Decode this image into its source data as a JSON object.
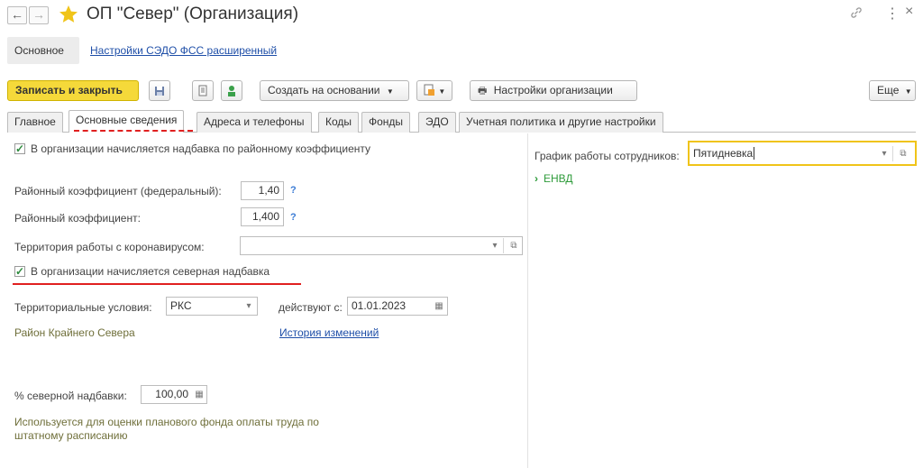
{
  "window": {
    "back": "←",
    "forward": "→",
    "title": "ОП \"Север\" (Организация)",
    "link_icon": "🔗",
    "more_icon": "⋮",
    "close_icon": "×"
  },
  "nav": {
    "main": "Основное",
    "link": "Настройки СЭДО ФСС расширенный"
  },
  "toolbar": {
    "save_close": "Записать и закрыть",
    "create_based": "Создать на основании",
    "org_settings": "Настройки организации",
    "more": "Еще"
  },
  "tabs": [
    "Главное",
    "Основные сведения",
    "Адреса и телефоны",
    "Коды",
    "Фонды",
    "ЭДО",
    "Учетная политика и другие настройки"
  ],
  "form": {
    "district_allowance_check": "В организации начисляется надбавка по районному коэффициенту",
    "district_coef_federal_label": "Районный коэффициент (федеральный):",
    "district_coef_federal_value": "1,40",
    "district_coef_label": "Районный коэффициент:",
    "district_coef_value": "1,400",
    "help_mark": "?",
    "covid_label": "Территория работы с коронавирусом:",
    "covid_value": "",
    "northern_check": "В организации начисляется северная надбавка",
    "territorial_label": "Территориальные условия:",
    "territorial_value": "РКС",
    "valid_from_label": "действуют с:",
    "valid_from_value": "01.01.2023",
    "district_name": "Район Крайнего Севера",
    "history_link": "История изменений",
    "northern_pct_label": "% северной надбавки:",
    "northern_pct_value": "100,00",
    "note_line1": "Используется для оценки планового фонда оплаты труда по",
    "note_line2": "штатному расписанию"
  },
  "right": {
    "schedule_label": "График работы сотрудников:",
    "schedule_value": "Пятидневка",
    "envd": "ЕНВД"
  },
  "colors": {
    "save_button": "#f5d93a",
    "accent_yellow": "#f0c419",
    "red_underline": "#e02020",
    "group_green": "#2e9b3a"
  }
}
